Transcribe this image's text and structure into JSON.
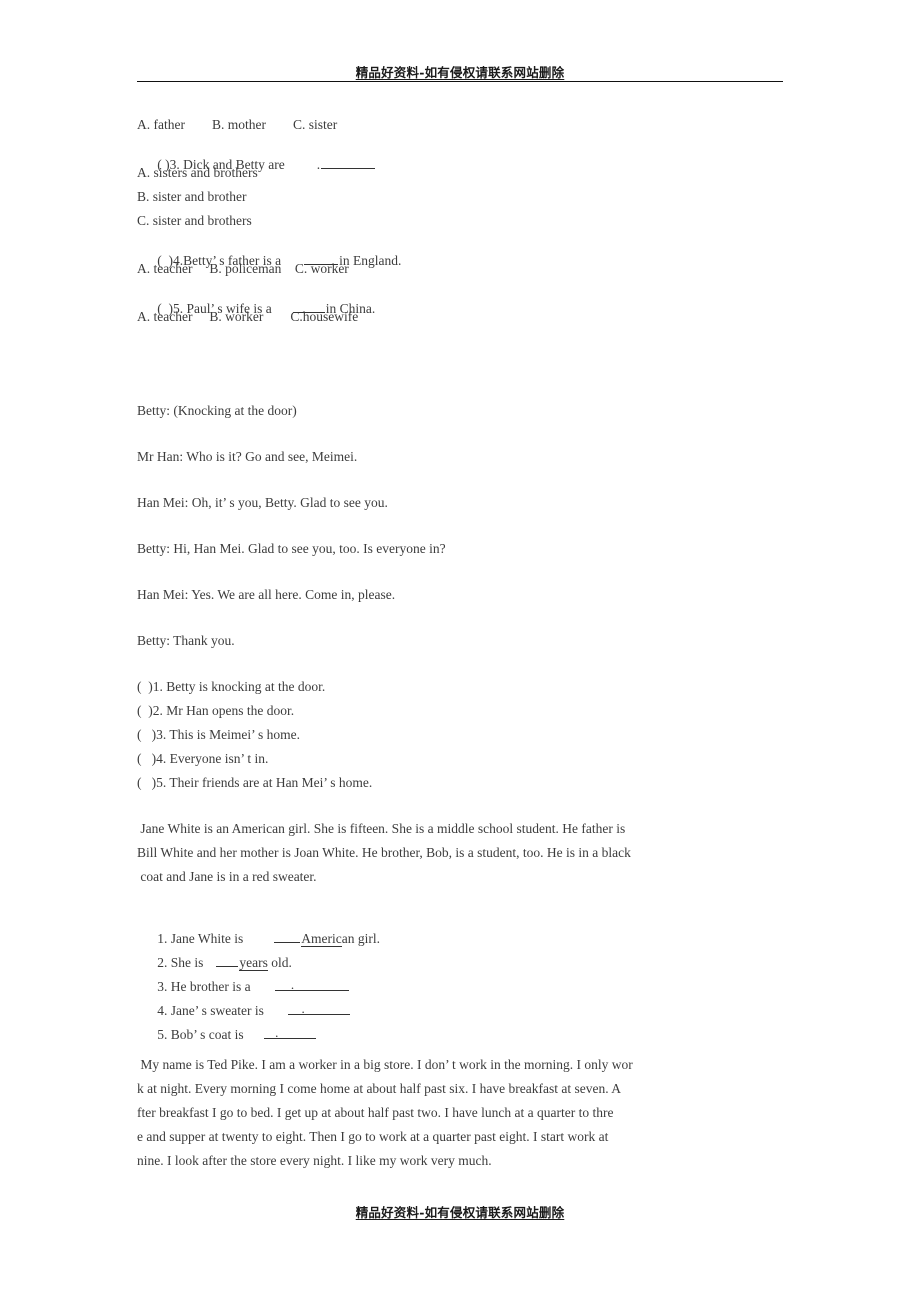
{
  "document": {
    "header_watermark": "精品好资料-如有侵权请联系网站删除",
    "footer_watermark": "精品好资料-如有侵权请联系网站删除"
  },
  "section_multiple_choice": {
    "q2_options": "A. father        B. mother        C. sister",
    "q3_stem_prefix": "( )3. Dick and Betty are",
    "q3_stem_period": ".",
    "q3_option_a": "A. sisters and brothers",
    "q3_option_b": "B. sister and brother",
    "q3_option_c": "C. sister and brothers",
    "q4_stem_prefix": "(  )4.Betty’ s father is a",
    "q4_stem_suffix": "in England.",
    "q4_options": "A. teacher     B. policeman    C. worker",
    "q5_stem_prefix": "(  )5. Paul’ s wife is a",
    "q5_stem_suffix": "in China.",
    "q5_options": "A. teacher     B. worker        C.housewife"
  },
  "section_dialogue": {
    "lines": [
      "Betty: (Knocking at the door)",
      "Mr Han: Who is it? Go and see, Meimei.",
      "Han Mei: Oh, it’ s you, Betty. Glad to see you.",
      "Betty: Hi, Han Mei. Glad to see you, too. Is everyone in?",
      "Han Mei: Yes. We are all here. Come in, please.",
      "Betty: Thank you."
    ]
  },
  "section_true_false": {
    "items": [
      "(  )1. Betty is knocking at the door.",
      "(  )2. Mr Han opens the door.",
      "(   )3. This is Meimei’ s home.",
      "(   )4. Everyone isn’ t in.",
      "(   )5. Their friends are at Han Mei’ s home."
    ]
  },
  "section_reading_jane": {
    "paragraph_lines": [
      " Jane White is an American girl. She is fifteen. She is a middle school student. He father is",
      "Bill White and her mother is Joan White. He brother, Bob, is a student, too. He is in a black",
      " coat and Jane is in a red sweater."
    ],
    "fill_q1_prefix": "1. Jane White is",
    "fill_q1_under": "Americ",
    "fill_q1_suffix": "an girl.",
    "fill_q2_prefix": "2. She is",
    "fill_q2_under": "years",
    "fill_q2_suffix": " old.",
    "fill_q3_prefix": "3. He brother is a",
    "fill_q4_prefix": "4. Jane’ s sweater is",
    "fill_q5_prefix": "5. Bob’ s coat is"
  },
  "section_reading_ted": {
    "paragraph_lines": [
      " My name is Ted Pike. I am a worker in a big store. I don’ t work in the morning. I only wor",
      "k at night. Every morning I come home at about half past six. I have breakfast at seven. A",
      "fter breakfast I go to bed. I get up at about half past two. I have lunch at a quarter to thre",
      "e and supper at twenty to eight. Then I go to work at a quarter past eight. I start work at",
      "nine. I look after the store every night. I like my work very much."
    ]
  },
  "colors": {
    "text": "#3c3c3c",
    "watermark": "#1a1a1a",
    "rule": "#111111",
    "page_background": "#ffffff"
  }
}
